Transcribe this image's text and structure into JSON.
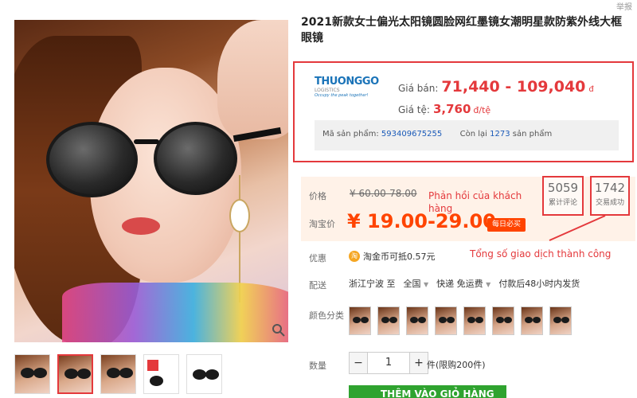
{
  "report_link": "举报",
  "title": "2021新款女士偏光太阳镜圆脸网红墨镜女潮明星款防紫外线大框眼镜",
  "thuonggo": {
    "brand": "THUONGGO",
    "sub": "LOGISTICS",
    "tagline": "Occupy the peak together!",
    "price_label": "Giá bán:",
    "price_value": "71,440 - 109,040",
    "price_unit": "đ",
    "rate_label": "Giá tệ:",
    "rate_value": "3,760",
    "rate_unit": "đ/tệ",
    "code_label": "Mã sản phẩm:",
    "code_value": "593409675255",
    "stock_label": "Còn lại",
    "stock_value": "1273",
    "stock_unit": "sản phẩm"
  },
  "taobao": {
    "price_label": "价格",
    "orig_price": "¥ 60.00-78.00",
    "tb_price_label": "淘宝价",
    "tb_price": "¥ 19.00-29.00",
    "daily_badge": "每日必买",
    "promo_label": "优惠",
    "coin_text": "淘金币可抵0.57元",
    "coin_glyph": "淘",
    "ship_label": "配送",
    "ship_from": "浙江宁波 至",
    "ship_to": "全国",
    "ship_speed": "快递 免运费",
    "ship_time": "付款后48小时内发货",
    "color_label": "颜色分类",
    "qty_label": "数量",
    "qty_value": "1",
    "qty_minus": "−",
    "qty_plus": "+",
    "qty_note": "件(限购200件)",
    "buy_label": "THÊM VÀO GIỎ HÀNG"
  },
  "stats": {
    "reviews_num": "5059",
    "reviews_label": "累计评论",
    "trades_num": "1742",
    "trades_label": "交易成功"
  },
  "annotations": {
    "reviews": "Phản hồi của khách hàng",
    "trades": "Tổng số giao dịch thành công"
  },
  "colors": {
    "accent_red": "#e4393c",
    "taobao_orange": "#ff4400",
    "buy_green": "#2fa32f",
    "link_blue": "#1a5ab8"
  }
}
